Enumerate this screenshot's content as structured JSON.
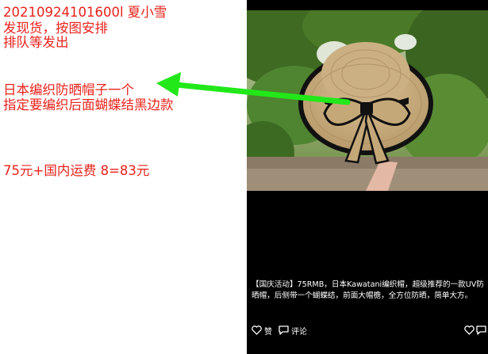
{
  "note": {
    "lines": [
      "20210924101600l    夏小雪",
      "发现货，按图安排",
      "排队等发出",
      "日本编织防晒帽子一个",
      "指定要编织后面蝴蝶结黑边款",
      "75元+国内运费 8=83元"
    ],
    "color": "#e8221b"
  },
  "arrow": {
    "color": "#22e81a"
  },
  "post": {
    "caption": "【国庆活动】75RMB，日本Kawatani编织帽，超级推荐的一款UV防晒帽，后侧带一个蝴蝶结，前面大帽檐，全方位防晒，简单大方。",
    "actions": {
      "like_label": "赞",
      "comment_label": "评论"
    },
    "background": "#000000"
  }
}
